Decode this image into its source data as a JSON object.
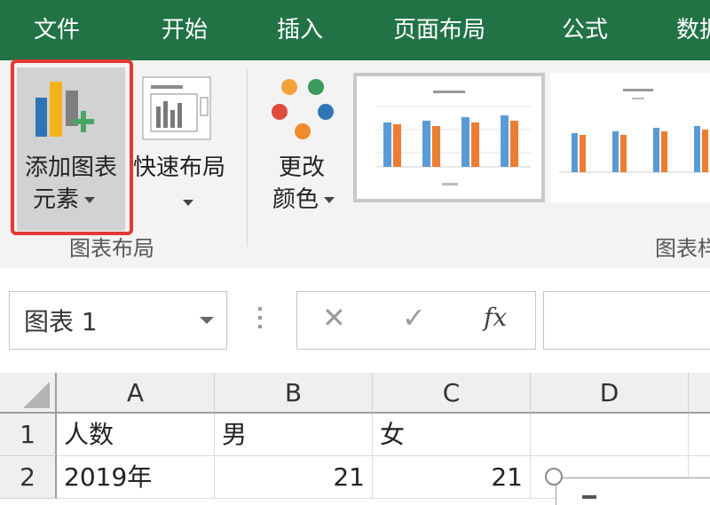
{
  "ribbon_tabs": [
    "文件",
    "开始",
    "插入",
    "页面布局",
    "公式",
    "数据"
  ],
  "chart_layouts_group": {
    "add_element_line1": "添加图表",
    "add_element_line2": "元素",
    "quick_layout": "快速布局",
    "group_label": "图表布局"
  },
  "change_colors": {
    "line1": "更改",
    "line2": "颜色"
  },
  "chart_styles_group_label": "图表样式",
  "chart_style_thumbnails": [
    "style-1",
    "style-2"
  ],
  "name_box": {
    "value": "图表 1"
  },
  "formula_bar": {
    "cancel_glyph": "✕",
    "enter_glyph": "✓",
    "fx_label": "fx",
    "value": ""
  },
  "column_headers": [
    "A",
    "B",
    "C",
    "D"
  ],
  "rows": [
    {
      "row_num": "1",
      "cells": [
        "人数",
        "男",
        "女",
        ""
      ]
    },
    {
      "row_num": "2",
      "cells": [
        "2019年",
        "21",
        "21",
        ""
      ]
    }
  ],
  "colors": {
    "ribbon_tab_bg": "#217346",
    "highlight_border": "#e53935",
    "bar_blue": "#5b9bd5",
    "bar_orange": "#ed7d31"
  }
}
